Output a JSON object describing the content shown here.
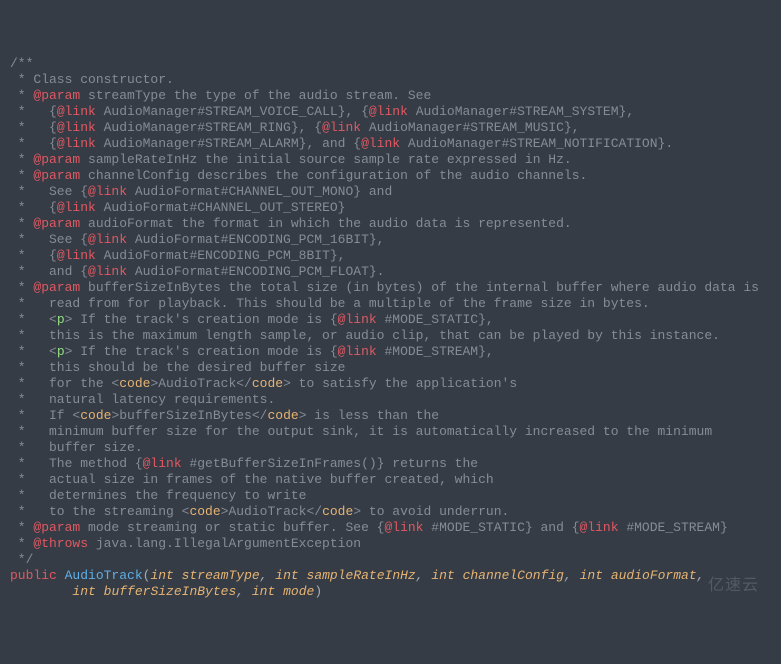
{
  "tokens": {
    "link": "@link",
    "param": "@param",
    "throws": "@throws",
    "p": "p",
    "code": "code",
    "public": "public",
    "int": "int",
    "AudioTrack": "AudioTrack"
  },
  "comment": {
    "open": "/**",
    "l01": " * Class constructor.",
    "l02a": " * ",
    "l02b": " streamType the type of the audio stream. See",
    "l03a": " *   {",
    "l03b": " AudioManager#STREAM_VOICE_CALL}, {",
    "l03c": " AudioManager#STREAM_SYSTEM},",
    "l04a": " *   {",
    "l04b": " AudioManager#STREAM_RING}, {",
    "l04c": " AudioManager#STREAM_MUSIC},",
    "l05a": " *   {",
    "l05b": " AudioManager#STREAM_ALARM}, and {",
    "l05c": " AudioManager#STREAM_NOTIFICATION}.",
    "l06a": " * ",
    "l06b": " sampleRateInHz the initial source sample rate expressed in Hz.",
    "l07a": " * ",
    "l07b": " channelConfig describes the configuration of the audio channels.",
    "l08a": " *   See {",
    "l08b": " AudioFormat#CHANNEL_OUT_MONO} and",
    "l09a": " *   {",
    "l09b": " AudioFormat#CHANNEL_OUT_STEREO}",
    "l10a": " * ",
    "l10b": " audioFormat the format in which the audio data is represented.",
    "l11a": " *   See {",
    "l11b": " AudioFormat#ENCODING_PCM_16BIT},",
    "l12a": " *   {",
    "l12b": " AudioFormat#ENCODING_PCM_8BIT},",
    "l13a": " *   and {",
    "l13b": " AudioFormat#ENCODING_PCM_FLOAT}.",
    "l14a": " * ",
    "l14b": " bufferSizeInBytes the total size (in bytes) of the internal buffer where audio data is",
    "l15": " *   read from for playback. This should be a multiple of the frame size in bytes.",
    "l16a": " *   <",
    "l16b": "> If the track's creation mode is {",
    "l16c": " #MODE_STATIC},",
    "l17": " *   this is the maximum length sample, or audio clip, that can be played by this instance.",
    "l18a": " *   <",
    "l18b": "> If the track's creation mode is {",
    "l18c": " #MODE_STREAM},",
    "l19": " *   this should be the desired buffer size",
    "l20a": " *   for the <",
    "l20b": ">AudioTrack</",
    "l20c": "> to satisfy the application's",
    "l21": " *   natural latency requirements.",
    "l22a": " *   If <",
    "l22b": ">bufferSizeInBytes</",
    "l22c": "> is less than the",
    "l23": " *   minimum buffer size for the output sink, it is automatically increased to the minimum",
    "l24": " *   buffer size.",
    "l25a": " *   The method {",
    "l25b": " #getBufferSizeInFrames()} returns the",
    "l26": " *   actual size in frames of the native buffer created, which",
    "l27": " *   determines the frequency to write",
    "l28a": " *   to the streaming <",
    "l28b": ">AudioTrack</",
    "l28c": "> to avoid underrun.",
    "l29a": " * ",
    "l29b": " mode streaming or static buffer. See {",
    "l29c": " #MODE_STATIC} and {",
    "l29d": " #MODE_STREAM}",
    "l30a": " * ",
    "l30b": " java.lang.IllegalArgumentException",
    "close": " */"
  },
  "sig": {
    "sp1": " ",
    "lp": "(",
    "c": ", ",
    "p1": "streamType",
    "p2": "sampleRateInHz",
    "p3": "channelConfig",
    "p4": "audioFormat",
    "p5": "bufferSizeInBytes",
    "p6": "mode",
    "rp": ")",
    "indent": "        "
  },
  "watermark": "亿速云"
}
